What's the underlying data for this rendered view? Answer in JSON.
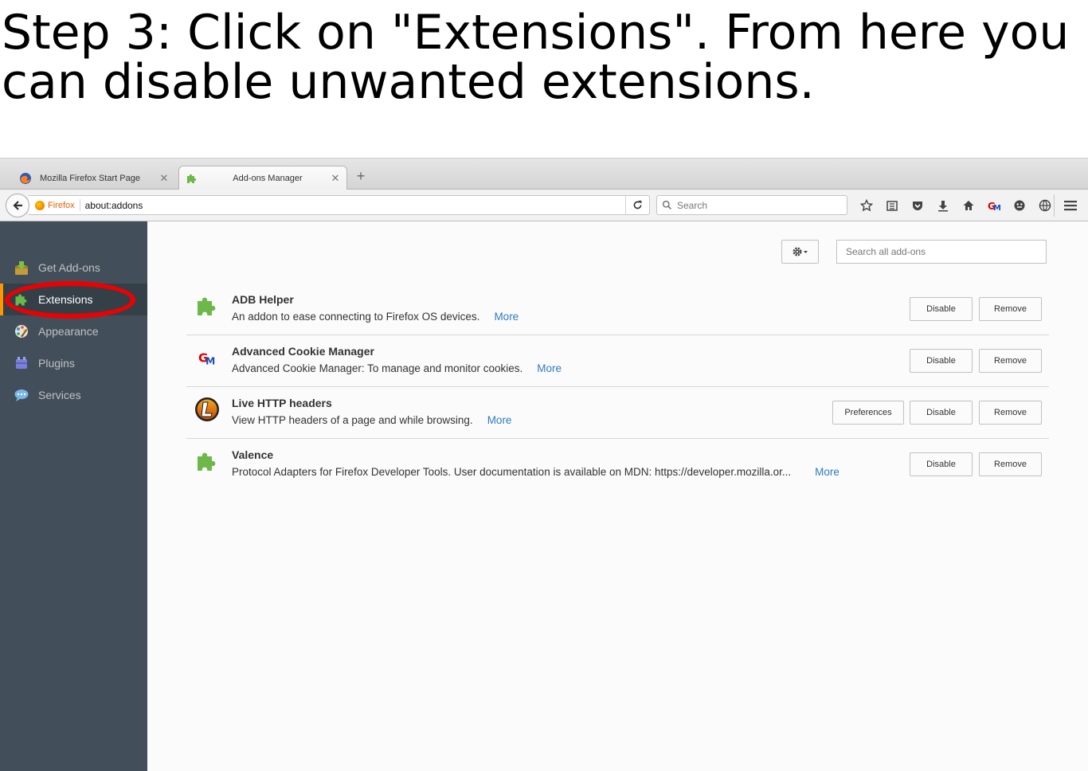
{
  "caption": "Step 3: Click on \"Extensions\". From here you can disable unwanted extensions.",
  "tabs": [
    {
      "label": "Mozilla Firefox Start Page",
      "icon": "firefox-icon",
      "close": "✕"
    },
    {
      "label": "Add-ons Manager",
      "icon": "puzzle-icon",
      "close": "✕"
    }
  ],
  "new_tab": "+",
  "navbar": {
    "identity": "Firefox",
    "url": "about:addons",
    "search_placeholder": "Search"
  },
  "sidebar": {
    "items": [
      {
        "label": "Get Add-ons",
        "icon": "get-addons-icon"
      },
      {
        "label": "Extensions",
        "icon": "extensions-icon"
      },
      {
        "label": "Appearance",
        "icon": "appearance-icon"
      },
      {
        "label": "Plugins",
        "icon": "plugins-icon"
      },
      {
        "label": "Services",
        "icon": "services-icon"
      }
    ],
    "selected": "Extensions"
  },
  "main": {
    "search_placeholder": "Search all add-ons",
    "addons": [
      {
        "name": "ADB Helper",
        "description": "An addon to ease connecting to Firefox OS devices.",
        "more": "More",
        "icon": "puzzle-icon",
        "buttons": {
          "disable": "Disable",
          "remove": "Remove"
        }
      },
      {
        "name": "Advanced Cookie Manager",
        "description": "Advanced Cookie Manager: To manage and monitor cookies.",
        "more": "More",
        "icon": "cookie-manager-icon",
        "buttons": {
          "disable": "Disable",
          "remove": "Remove"
        }
      },
      {
        "name": "Live HTTP headers",
        "description": "View HTTP headers of a page and while browsing.",
        "more": "More",
        "icon": "live-http-headers-icon",
        "buttons": {
          "preferences": "Preferences",
          "disable": "Disable",
          "remove": "Remove"
        }
      },
      {
        "name": "Valence",
        "description": "Protocol Adapters for Firefox Developer Tools. User documentation is available on MDN: https://developer.mozilla.or...",
        "more": "More",
        "icon": "puzzle-icon",
        "buttons": {
          "disable": "Disable",
          "remove": "Remove"
        }
      }
    ]
  },
  "colors": {
    "sidebar_bg": "#424f5a",
    "sidebar_selected": "#343f48",
    "accent": "#ff9500",
    "annotation": "#ee0000",
    "puzzle_green": "#6cb94a",
    "link": "#2e7bc5"
  }
}
